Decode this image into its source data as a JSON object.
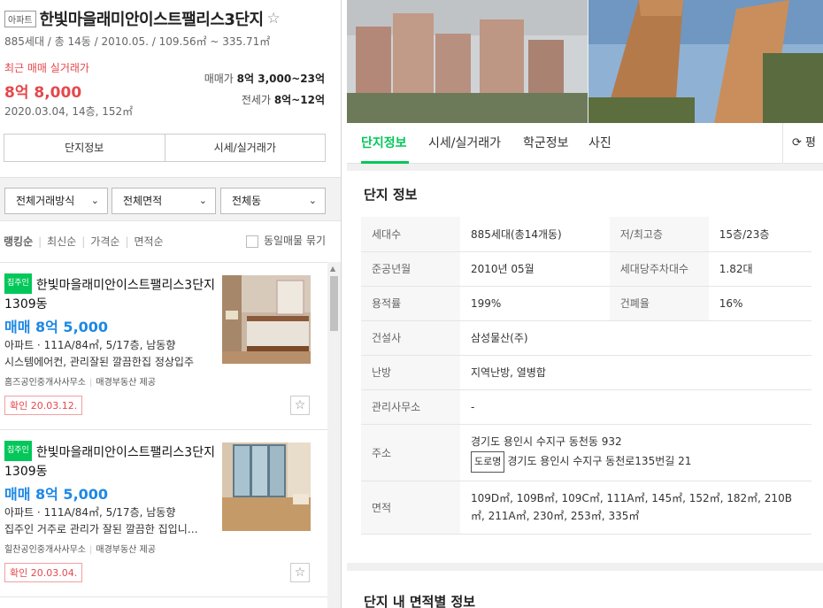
{
  "complex": {
    "type_tag": "아파트",
    "name": "한빛마을래미안이스트팰리스3단지",
    "summary": "885세대 / 총 14동 / 2010.05. / 109.56㎡ ~ 335.71㎡",
    "recent_label": "최근 매매 실거래가",
    "recent_price": "8억 8,000",
    "recent_detail": "2020.03.04, 14층, 152㎡",
    "sale_label": "매매가",
    "sale_range": "8억 3,000~23억",
    "jeonse_label": "전세가",
    "jeonse_range": "8억~12억"
  },
  "left_tabs": [
    "단지정보",
    "시세/실거래가"
  ],
  "filters": [
    "전체거래방식",
    "전체면적",
    "전체동"
  ],
  "sort": {
    "options": [
      "랭킹순",
      "최신순",
      "가격순",
      "면적순"
    ],
    "same_listing": "동일매물 묶기"
  },
  "listings": [
    {
      "badge": "집주인",
      "title": "한빛마을래미안이스트팰리스3단지 1309동",
      "price": "매매 8억 5,000",
      "spec": "아파트 · 111A/84㎡, 5/17층, 남동향",
      "desc": "시스템에어컨, 관리잘된 깔끔한집 정상입주",
      "agency": "홈즈공인중개사사무소",
      "provider": "매경부동산 제공",
      "confirmed": "확인 20.03.12."
    },
    {
      "badge": "집주인",
      "title": "한빛마을래미안이스트팰리스3단지 1309동",
      "price": "매매 8억 5,000",
      "spec": "아파트 · 111A/84㎡, 5/17층, 남동향",
      "desc": "집주인 거주로 관리가 잘된 깔끔한 집입니…",
      "agency": "힐찬공인중개사사무소",
      "provider": "매경부동산 제공",
      "confirmed": "확인 20.03.04."
    }
  ],
  "right_tabs": [
    "단지정보",
    "시세/실거래가",
    "학군정보",
    "사진"
  ],
  "refresh_label": "평",
  "info": {
    "heading": "단지 정보",
    "households_k": "세대수",
    "households_v": "885세대(총14개동)",
    "floors_k": "저/최고층",
    "floors_v": "15층/23층",
    "completed_k": "준공년월",
    "completed_v": "2010년 05월",
    "parking_k": "세대당주차대수",
    "parking_v": "1.82대",
    "far_k": "용적률",
    "far_v": "199%",
    "bcr_k": "건폐율",
    "bcr_v": "16%",
    "builder_k": "건설사",
    "builder_v": "삼성물산(주)",
    "heating_k": "난방",
    "heating_v": "지역난방, 열병합",
    "mgmt_k": "관리사무소",
    "mgmt_v": "-",
    "address_k": "주소",
    "address_v": "경기도 용인시 수지구 동천동 932",
    "road_tag": "도로명",
    "road_v": "경기도 용인시 수지구 동천로135번길 21",
    "area_k": "면적",
    "area_v": "109D㎡, 109B㎡, 109C㎡, 111A㎡, 145㎡, 152㎡, 182㎡, 210B㎡, 211A㎡, 230㎡, 253㎡, 335㎡"
  },
  "section2_heading": "단지 내 면적별 정보"
}
